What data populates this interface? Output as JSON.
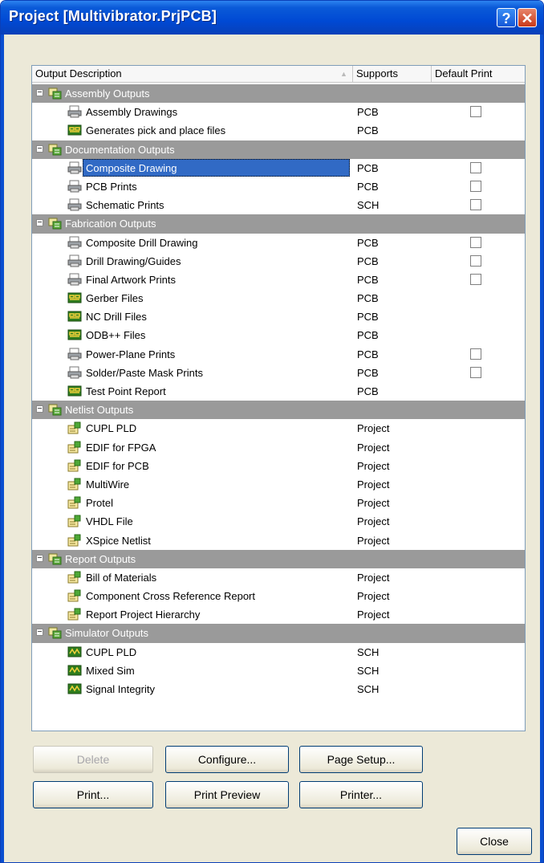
{
  "window": {
    "title": "Project [Multivibrator.PrjPCB]",
    "help_glyph": "?",
    "close_glyph": "✕"
  },
  "columns": {
    "description": "Output Description",
    "supports": "Supports",
    "default_print": "Default Print"
  },
  "groups": [
    {
      "label": "Assembly Outputs",
      "items": [
        {
          "label": "Assembly Drawings",
          "supports": "PCB",
          "icon": "print-icon",
          "checkbox": true
        },
        {
          "label": "Generates pick and place files",
          "supports": "PCB",
          "icon": "file-gen-icon",
          "checkbox": false
        }
      ]
    },
    {
      "label": "Documentation Outputs",
      "items": [
        {
          "label": "Composite Drawing",
          "supports": "PCB",
          "icon": "print-icon",
          "checkbox": true,
          "selected": true
        },
        {
          "label": "PCB Prints",
          "supports": "PCB",
          "icon": "print-icon",
          "checkbox": true
        },
        {
          "label": "Schematic Prints",
          "supports": "SCH",
          "icon": "print-icon",
          "checkbox": true
        }
      ]
    },
    {
      "label": "Fabrication Outputs",
      "items": [
        {
          "label": "Composite Drill Drawing",
          "supports": "PCB",
          "icon": "print-icon",
          "checkbox": true
        },
        {
          "label": "Drill Drawing/Guides",
          "supports": "PCB",
          "icon": "print-icon",
          "checkbox": true
        },
        {
          "label": "Final Artwork Prints",
          "supports": "PCB",
          "icon": "print-icon",
          "checkbox": true
        },
        {
          "label": "Gerber Files",
          "supports": "PCB",
          "icon": "file-gen-icon",
          "checkbox": false
        },
        {
          "label": "NC Drill Files",
          "supports": "PCB",
          "icon": "file-gen-icon",
          "checkbox": false
        },
        {
          "label": "ODB++ Files",
          "supports": "PCB",
          "icon": "file-gen-icon",
          "checkbox": false
        },
        {
          "label": "Power-Plane Prints",
          "supports": "PCB",
          "icon": "print-icon",
          "checkbox": true
        },
        {
          "label": "Solder/Paste Mask Prints",
          "supports": "PCB",
          "icon": "print-icon",
          "checkbox": true
        },
        {
          "label": "Test Point Report",
          "supports": "PCB",
          "icon": "file-gen-icon",
          "checkbox": false
        }
      ]
    },
    {
      "label": "Netlist Outputs",
      "items": [
        {
          "label": "CUPL PLD",
          "supports": "Project",
          "icon": "netlist-icon",
          "checkbox": false
        },
        {
          "label": "EDIF for FPGA",
          "supports": "Project",
          "icon": "netlist-icon",
          "checkbox": false
        },
        {
          "label": "EDIF for PCB",
          "supports": "Project",
          "icon": "netlist-icon",
          "checkbox": false
        },
        {
          "label": "MultiWire",
          "supports": "Project",
          "icon": "netlist-icon",
          "checkbox": false
        },
        {
          "label": "Protel",
          "supports": "Project",
          "icon": "netlist-icon",
          "checkbox": false
        },
        {
          "label": "VHDL File",
          "supports": "Project",
          "icon": "netlist-icon",
          "checkbox": false
        },
        {
          "label": "XSpice Netlist",
          "supports": "Project",
          "icon": "netlist-icon",
          "checkbox": false
        }
      ]
    },
    {
      "label": "Report Outputs",
      "items": [
        {
          "label": "Bill of Materials",
          "supports": "Project",
          "icon": "netlist-icon",
          "checkbox": false
        },
        {
          "label": "Component Cross Reference Report",
          "supports": "Project",
          "icon": "netlist-icon",
          "checkbox": false
        },
        {
          "label": "Report Project Hierarchy",
          "supports": "Project",
          "icon": "netlist-icon",
          "checkbox": false
        }
      ]
    },
    {
      "label": "Simulator Outputs",
      "items": [
        {
          "label": "CUPL PLD",
          "supports": "SCH",
          "icon": "sim-icon",
          "checkbox": false
        },
        {
          "label": "Mixed Sim",
          "supports": "SCH",
          "icon": "sim-icon",
          "checkbox": false
        },
        {
          "label": "Signal Integrity",
          "supports": "SCH",
          "icon": "sim-icon",
          "checkbox": false
        }
      ]
    }
  ],
  "buttons": {
    "delete": "Delete",
    "configure": "Configure...",
    "page_setup": "Page Setup...",
    "print": "Print...",
    "print_preview": "Print Preview",
    "printer": "Printer...",
    "close": "Close"
  },
  "colors": {
    "titlebar": "#0049d4",
    "group_row": "#9a9a9a",
    "selection": "#316ac5"
  }
}
